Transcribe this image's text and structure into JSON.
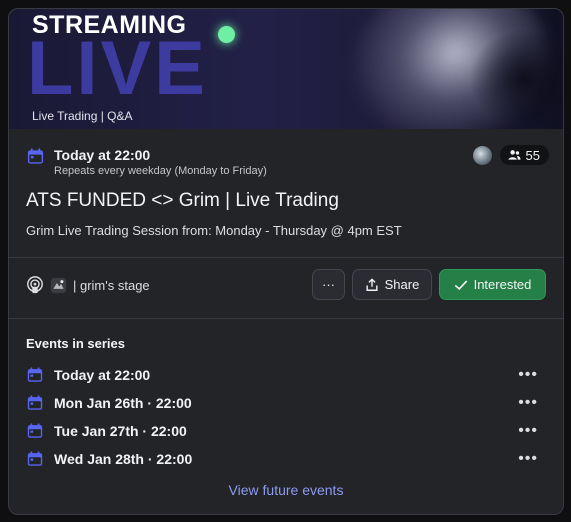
{
  "banner": {
    "title_top": "STREAMING",
    "title_big": "LIVE",
    "subtitle": "Live Trading | Q&A"
  },
  "event": {
    "when": "Today at 22:00",
    "repeat": "Repeats every weekday (Monday to Friday)",
    "interested_count": "55",
    "title": "ATS FUNDED <> Grim | Live Trading",
    "description": "Grim Live Trading Session from: Monday - Thursday @ 4pm EST",
    "location": "| grim's stage"
  },
  "actions": {
    "more": "···",
    "share": "Share",
    "interested": "Interested"
  },
  "series": {
    "label": "Events in series",
    "items": [
      {
        "text": "Today at 22:00"
      },
      {
        "text": "Mon Jan 26th · 22:00"
      },
      {
        "text": "Tue Jan 27th · 22:00"
      },
      {
        "text": "Wed Jan 28th · 22:00"
      }
    ],
    "more_glyph": "•••",
    "view_future": "View future events"
  },
  "colors": {
    "accent": "#5865f2",
    "interested_green": "#248046",
    "link": "#8c9bf0"
  }
}
